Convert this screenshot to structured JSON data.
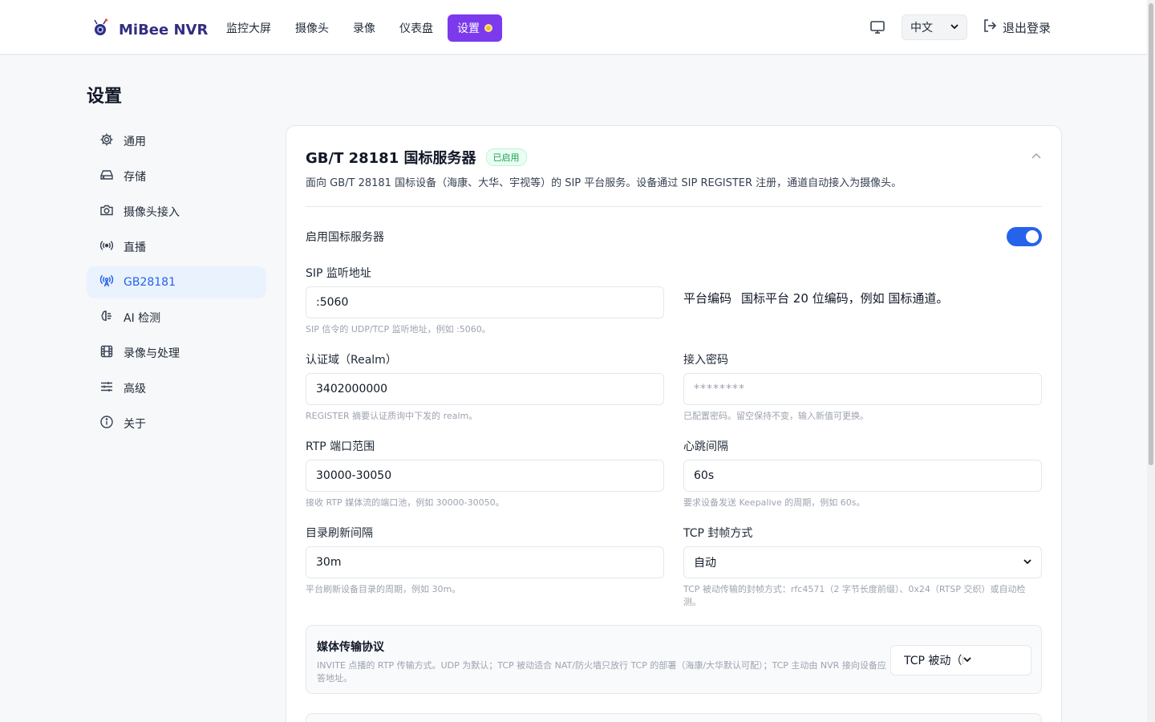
{
  "brand": {
    "name": "MiBee NVR"
  },
  "nav": [
    {
      "label": "监控大屏"
    },
    {
      "label": "摄像头"
    },
    {
      "label": "录像"
    },
    {
      "label": "仪表盘"
    },
    {
      "label": "设置"
    }
  ],
  "top_right": {
    "language": "中文",
    "logout": "退出登录"
  },
  "page_title": "设置",
  "sidebar": [
    {
      "label": "通用"
    },
    {
      "label": "存储"
    },
    {
      "label": "摄像头接入"
    },
    {
      "label": "直播"
    },
    {
      "label": "GB28181"
    },
    {
      "label": "AI 检测"
    },
    {
      "label": "录像与处理"
    },
    {
      "label": "高级"
    },
    {
      "label": "关于"
    }
  ],
  "card": {
    "title": "GB/T 28181 国标服务器",
    "badge": "已启用",
    "desc": "面向 GB/T 28181 国标设备（海康、大华、宇视等）的 SIP 平台服务。设备通过 SIP REGISTER 注册，通道自动接入为摄像头。",
    "toggle_label": "启用国标服务器",
    "platform_code_label": "平台编码",
    "platform_code_text": "国标平台 20 位编码，例如 国标通道。",
    "fields": {
      "sip": {
        "label": "SIP 监听地址",
        "value": ":5060",
        "hint": "SIP 信令的 UDP/TCP 监听地址，例如 :5060。"
      },
      "realm": {
        "label": "认证域（Realm）",
        "value": "3402000000",
        "hint": "REGISTER 摘要认证质询中下发的 realm。"
      },
      "password": {
        "label": "接入密码",
        "placeholder": "********",
        "hint": "已配置密码。留空保持不变，输入新值可更换。"
      },
      "rtp": {
        "label": "RTP 端口范围",
        "value": "30000-30050",
        "hint": "接收 RTP 媒体流的端口池，例如 30000-30050。"
      },
      "heartbeat": {
        "label": "心跳间隔",
        "value": "60s",
        "hint": "要求设备发送 Keepalive 的周期，例如 60s。"
      },
      "catalog": {
        "label": "目录刷新间隔",
        "value": "30m",
        "hint": "平台刷新设备目录的周期，例如 30m。"
      },
      "tcp_framing": {
        "label": "TCP 封帧方式",
        "value": "自动",
        "hint": "TCP 被动传输的封帧方式：rfc4571（2 字节长度前缀）、0x24（RTSP 交织）或自动检测。"
      }
    },
    "media": {
      "title": "媒体传输协议",
      "desc": "INVITE 点播的 RTP 传输方式。UDP 为默认；TCP 被动适合 NAT/防火墙只放行 TCP 的部署（海康/大华默认可配）；TCP 主动由 NVR 接向设备应答地址。",
      "value": "TCP 被动（NVR 监听）"
    }
  }
}
